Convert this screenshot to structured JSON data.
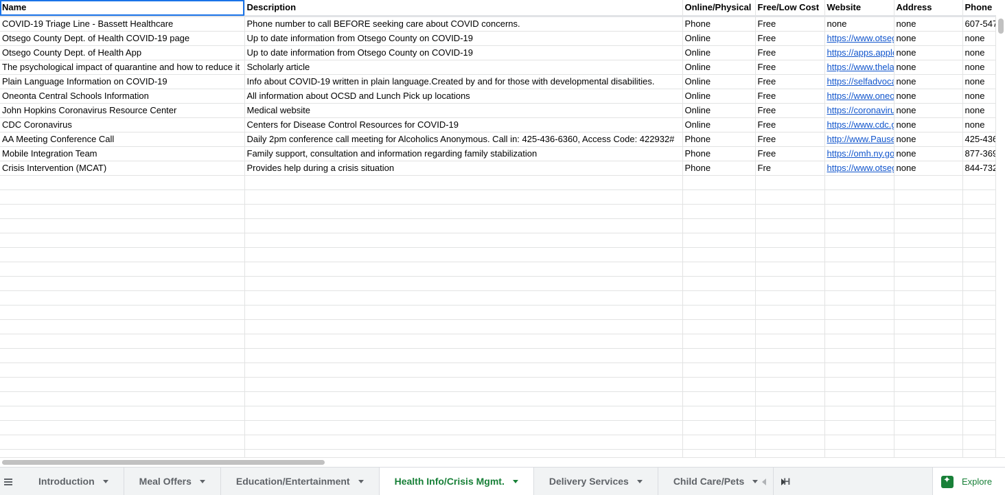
{
  "sheet": {
    "columns": [
      {
        "label": "Name",
        "width": 356
      },
      {
        "label": "Description",
        "width": 638
      },
      {
        "label": "Online/Physical",
        "width": 106
      },
      {
        "label": "Free/Low Cost",
        "width": 101
      },
      {
        "label": "Website",
        "width": 101
      },
      {
        "label": "Address",
        "width": 100
      },
      {
        "label": "Phone",
        "width": 48
      }
    ],
    "rows": [
      [
        "COVID-19 Triage Line - Bassett Healthcare",
        "Phone number to call BEFORE seeking care about COVID concerns.",
        "Phone",
        "Free",
        "none",
        "none",
        "607-547"
      ],
      [
        "Otsego County Dept. of Health COVID-19 page",
        "Up to date information from Otsego County on COVID-19",
        "Online",
        "Free",
        "https://www.otsego",
        "none",
        "none"
      ],
      [
        "Otsego County Dept. of Health App",
        "Up to date information from Otsego County on COVID-19",
        "Online",
        "Free",
        "https://apps.apple",
        "none",
        "none"
      ],
      [
        "The psychological impact of quarantine and how to reduce it",
        "Scholarly article",
        "Online",
        "Free",
        "https://www.thelancet",
        "none",
        "none"
      ],
      [
        "Plain Language Information on COVID-19",
        "Info about COVID-19 written in plain language.Created by and for those with developmental disabilities.",
        "Online",
        "Free",
        "https://selfadvocacy",
        "none",
        "none"
      ],
      [
        "Oneonta Central Schools Information",
        "All information about OCSD and Lunch Pick up locations",
        "Online",
        "Free",
        "https://www.oneonta",
        "none",
        "none"
      ],
      [
        "John Hopkins Coronavirus Resource Center",
        "Medical website",
        "Online",
        "Free",
        "https://coronavirus",
        "none",
        "none"
      ],
      [
        "CDC Coronavirus",
        "Centers for Disease Control Resources for COVID-19",
        "Online",
        "Free",
        "https://www.cdc.gov",
        "none",
        "none"
      ],
      [
        "AA Meeting Conference Call",
        "Daily 2pm conference call meeting for Alcoholics Anonymous. Call in: 425-436-6360, Access Code: 422932#",
        "Phone",
        "Free",
        "http://www.Pause",
        "none",
        "425-436"
      ],
      [
        "Mobile Integration Team",
        "Family support, consultation and information regarding family stabilization",
        "Phone",
        "Free",
        "https://omh.ny.gov",
        "none",
        "877-369"
      ],
      [
        "Crisis Intervention (MCAT)",
        "Provides help during a crisis situation",
        "Phone",
        "Fre",
        "https://www.otsego",
        "none",
        "844-732"
      ]
    ],
    "empty_rows": 20
  },
  "tabs": [
    {
      "label": "Introduction",
      "active": false
    },
    {
      "label": "Meal Offers",
      "active": false
    },
    {
      "label": "Education/Entertainment",
      "active": false
    },
    {
      "label": "Health Info/Crisis Mgmt.",
      "active": true
    },
    {
      "label": "Delivery Services",
      "active": false
    },
    {
      "label": "Child Care/Pets",
      "active": false
    }
  ],
  "tab_partial": "H",
  "explore_label": "Explore"
}
